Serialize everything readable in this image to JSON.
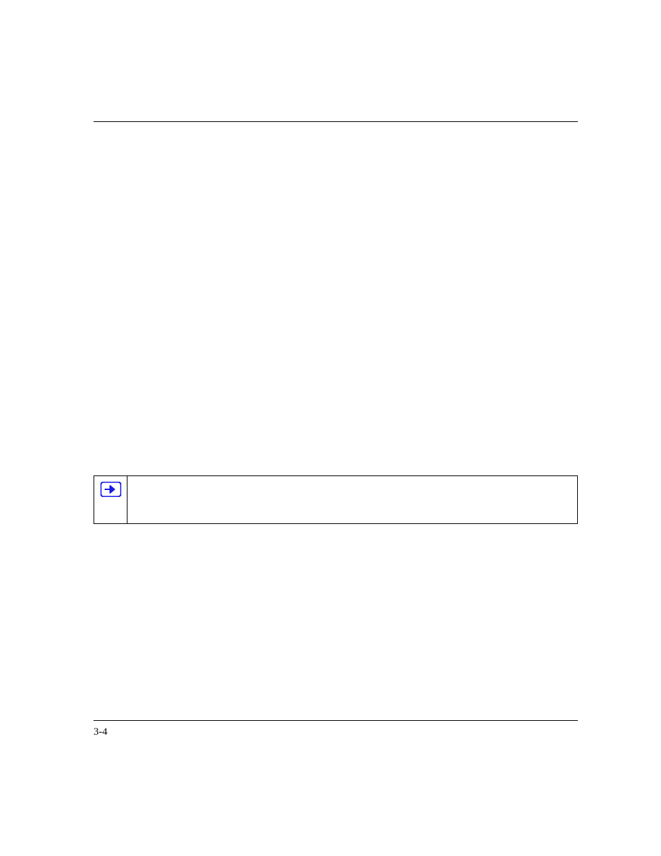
{
  "header": {
    "title": ""
  },
  "note": {
    "text": ""
  },
  "footer": {
    "page_number": "3-4"
  }
}
